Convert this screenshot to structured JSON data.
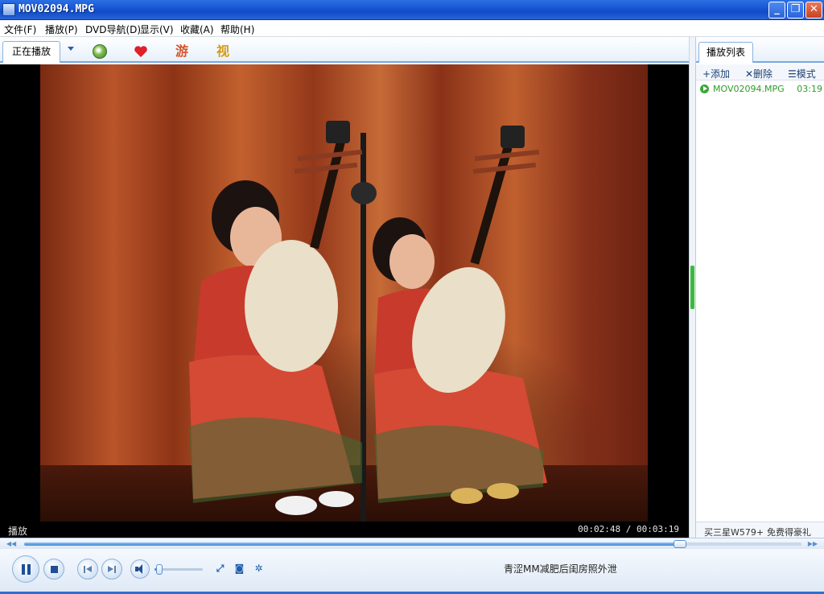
{
  "window": {
    "title": "MOV02094.MPG",
    "minimize_symbol": "_",
    "maximize_symbol": "❐",
    "close_symbol": "✕"
  },
  "menu": {
    "items": [
      "文件(F)",
      "播放(P)",
      "DVD导航(D)",
      "显示(V)",
      "收藏(A)",
      "帮助(H)"
    ]
  },
  "toolbar": {
    "active_tab": "正在播放",
    "icons": [
      "globe-icon",
      "heart-icon",
      "game-icon",
      "film-icon"
    ],
    "game_glyph": "游",
    "film_glyph": "视"
  },
  "video": {
    "state_label": "播放",
    "time_display": "00:02:48 / 00:03:19"
  },
  "playlist": {
    "tab_label": "播放列表",
    "actions": {
      "add": "+添加",
      "delete": "✕删除",
      "mode": "☰模式"
    },
    "items": [
      {
        "name": "MOV02094.MPG",
        "duration": "03:19"
      }
    ],
    "ad_left": "买三星W579+",
    "ad_right": "免费得豪礼"
  },
  "seek": {
    "progress": 0.844,
    "left_arrow": "◀◀",
    "right_arrow": "▶▶"
  },
  "controls": {
    "volume": 0.1,
    "fullscreen_glyph": "⤢",
    "snapshot_glyph": "◙",
    "settings_glyph": "✲",
    "marquee_text": "青涩MM减肥后闺房照外泄"
  },
  "colors": {
    "accent": "#2d6fd1",
    "playlist_green": "#2f9a2a",
    "close_red": "#c8431f"
  }
}
